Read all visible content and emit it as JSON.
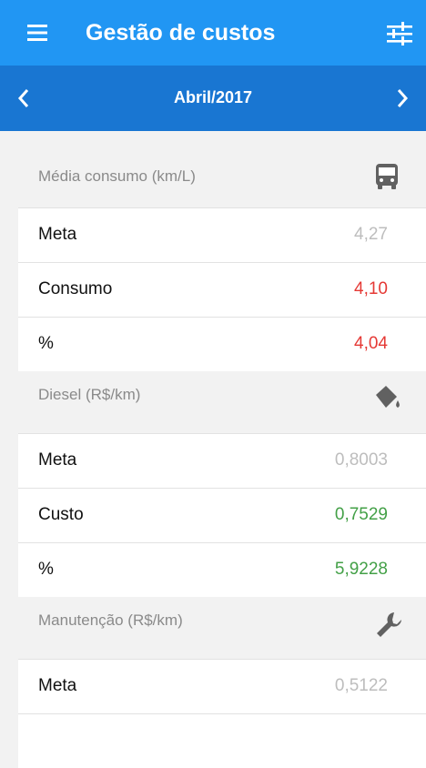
{
  "appbar": {
    "title": "Gestão de custos",
    "menu_icon": "menu-icon",
    "filter_icon": "sliders-icon"
  },
  "period": {
    "label": "Abril/2017"
  },
  "sections": {
    "consumo": {
      "title": "Média consumo (km/L)",
      "icon": "bus-icon",
      "rows": [
        {
          "label": "Meta",
          "value": "4,27",
          "color": "#bdbdbd"
        },
        {
          "label": "Consumo",
          "value": "4,10",
          "color": "#e53935"
        },
        {
          "label": "%",
          "value": "4,04",
          "color": "#e53935"
        }
      ]
    },
    "diesel": {
      "title": "Diesel (R$/km)",
      "icon": "paint-bucket-icon",
      "rows": [
        {
          "label": "Meta",
          "value": "0,8003",
          "color": "#bdbdbd"
        },
        {
          "label": "Custo",
          "value": "0,7529",
          "color": "#43a047"
        },
        {
          "label": "%",
          "value": "5,9228",
          "color": "#43a047"
        }
      ]
    },
    "manutencao": {
      "title": "Manutenção (R$/km)",
      "icon": "wrench-icon",
      "rows": [
        {
          "label": "Meta",
          "value": "0,5122",
          "color": "#bdbdbd"
        }
      ]
    }
  },
  "colors": {
    "primary": "#2196f3",
    "primary_dark": "#1976d2",
    "negative": "#e53935",
    "positive": "#43a047",
    "muted": "#bdbdbd"
  }
}
